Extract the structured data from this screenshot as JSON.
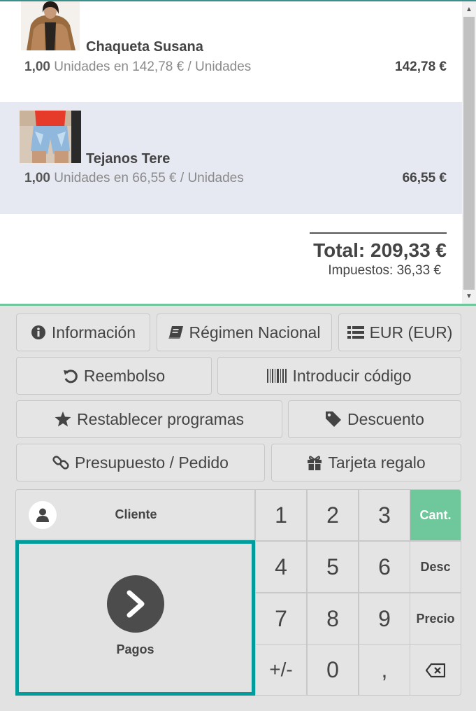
{
  "order": {
    "lines": [
      {
        "name": "Chaqueta Susana",
        "qty": "1,00",
        "unit_text": "Unidades en 142,78 € / Unidades",
        "price": "142,78 €",
        "image": "jacket-photo"
      },
      {
        "name": "Tejanos Tere",
        "qty": "1,00",
        "unit_text": "Unidades en 66,55 € / Unidades",
        "price": "66,55 €",
        "image": "jeans-photo"
      }
    ],
    "total": "Total: 209,33 €",
    "taxes": "Impuestos: 36,33 €"
  },
  "controls": {
    "informacion": "Información",
    "regimen": "Régimen Nacional",
    "currency": "EUR (EUR)",
    "reembolso": "Reembolso",
    "codigo": "Introducir código",
    "programas": "Restablecer programas",
    "descuento": "Descuento",
    "presupuesto": "Presupuesto / Pedido",
    "tarjeta": "Tarjeta regalo"
  },
  "pad": {
    "cliente": "Cliente",
    "pagos": "Pagos",
    "keys": [
      "1",
      "2",
      "3",
      "4",
      "5",
      "6",
      "7",
      "8",
      "9",
      "+/-",
      "0",
      ","
    ],
    "modes": {
      "cant": "Cant.",
      "desc": "Desc",
      "precio": "Precio"
    },
    "active_mode": "Cant."
  },
  "colors": {
    "accent": "#6ec89b",
    "pay_border": "#019c9b",
    "selected_line": "#e6e8f2"
  }
}
